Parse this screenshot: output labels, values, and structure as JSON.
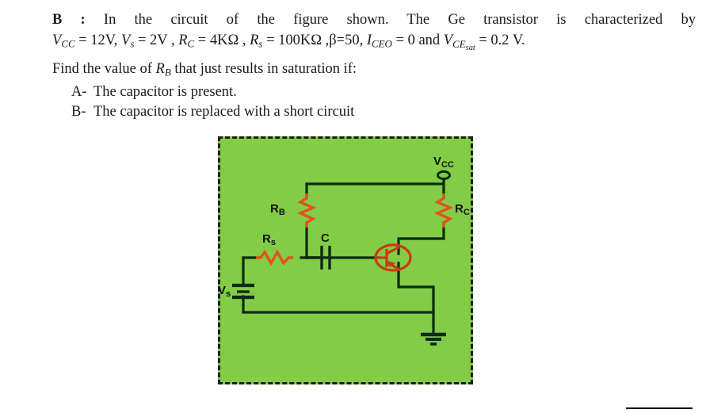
{
  "document": {
    "problem": {
      "label": "B :",
      "line1_text": "In the circuit of the figure shown. The Ge transistor is characterized by",
      "line2": {
        "vcc_sym": "V",
        "vcc_sub": "CC",
        "vcc_eq": " = 12V,",
        "vs_sym": "V",
        "vs_sub": "s",
        "vs_eq": " = 2V ,",
        "rc_sym": "R",
        "rc_sub": "C",
        "rc_eq": " = 4KΩ ,",
        "rs_sym": "R",
        "rs_sub": "s",
        "rs_eq": " = 100KΩ ,",
        "beta_eq": "β=50,",
        "iceo_sym": "I",
        "iceo_sub": "CEO",
        "iceo_eq": " = 0 and",
        "vcesat_sym": "V",
        "vcesat_sub": "CE",
        "vcesat_subsub": "sat",
        "vcesat_eq": " = 0.2 V."
      },
      "line3_pre": "Find the value of ",
      "line3_rb_sym": "R",
      "line3_rb_sub": "B",
      "line3_post": " that just results in saturation if:",
      "items": [
        {
          "tag": "A-",
          "text": "The capacitor is present."
        },
        {
          "tag": "B-",
          "text": "The capacitor is replaced with a short circuit"
        }
      ]
    },
    "figure": {
      "background_color": "#82cc46",
      "wire_color": "#0d2b14",
      "component_color": "#e2521d",
      "border_style": "dashed",
      "labels": {
        "vcc": "V",
        "vcc_sub": "CC",
        "rb": "R",
        "rb_sub": "B",
        "rc": "R",
        "rc_sub": "C",
        "rs": "R",
        "rs_sub": "s",
        "cap": "C",
        "vs": "V",
        "vs_sub": "s"
      },
      "components": [
        {
          "name": "supply-terminal-vcc",
          "type": "terminal"
        },
        {
          "name": "resistor-rb",
          "type": "resistor"
        },
        {
          "name": "resistor-rc",
          "type": "resistor"
        },
        {
          "name": "resistor-rs",
          "type": "resistor"
        },
        {
          "name": "capacitor-c",
          "type": "capacitor"
        },
        {
          "name": "battery-vs",
          "type": "battery"
        },
        {
          "name": "transistor-q",
          "type": "bjt"
        },
        {
          "name": "ground",
          "type": "ground"
        }
      ]
    }
  }
}
